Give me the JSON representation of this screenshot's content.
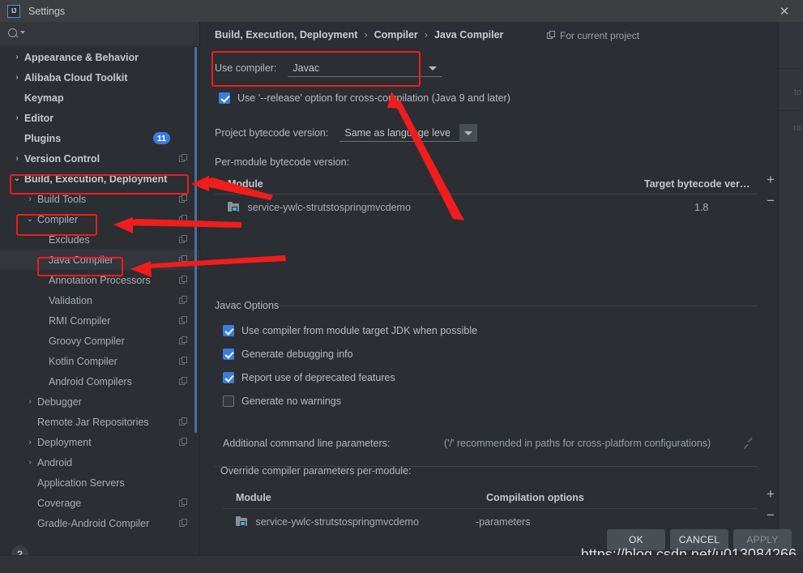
{
  "window": {
    "title": "Settings",
    "logo_text": "IJ",
    "close_label": "✕"
  },
  "search": {
    "placeholder": "",
    "value": "",
    "icon": "search-icon"
  },
  "sidebar": {
    "items": [
      {
        "label": "Appearance & Behavior",
        "twisty": "›",
        "bold": true,
        "indent": 30,
        "copy": false,
        "badge": null,
        "selected": false
      },
      {
        "label": "Alibaba Cloud Toolkit",
        "twisty": "›",
        "bold": true,
        "indent": 30,
        "copy": false,
        "badge": null,
        "selected": false
      },
      {
        "label": "Keymap",
        "twisty": "",
        "bold": true,
        "indent": 30,
        "copy": false,
        "badge": null,
        "selected": false
      },
      {
        "label": "Editor",
        "twisty": "›",
        "bold": true,
        "indent": 30,
        "copy": false,
        "badge": null,
        "selected": false
      },
      {
        "label": "Plugins",
        "twisty": "",
        "bold": true,
        "indent": 30,
        "copy": false,
        "badge": "11",
        "selected": false
      },
      {
        "label": "Version Control",
        "twisty": "›",
        "bold": true,
        "indent": 30,
        "copy": true,
        "badge": null,
        "selected": false
      },
      {
        "label": "Build, Execution, Deployment",
        "twisty": "⌄",
        "bold": true,
        "indent": 30,
        "copy": false,
        "badge": null,
        "selected": false
      },
      {
        "label": "Build Tools",
        "twisty": "›",
        "bold": false,
        "indent": 46,
        "copy": true,
        "badge": null,
        "selected": false
      },
      {
        "label": "Compiler",
        "twisty": "⌄",
        "bold": false,
        "indent": 46,
        "copy": true,
        "badge": null,
        "selected": false
      },
      {
        "label": "Excludes",
        "twisty": "",
        "bold": false,
        "indent": 60,
        "copy": true,
        "badge": null,
        "selected": false
      },
      {
        "label": "Java Compiler",
        "twisty": "",
        "bold": false,
        "indent": 60,
        "copy": true,
        "badge": null,
        "selected": true
      },
      {
        "label": "Annotation Processors",
        "twisty": "",
        "bold": false,
        "indent": 60,
        "copy": true,
        "badge": null,
        "selected": false
      },
      {
        "label": "Validation",
        "twisty": "",
        "bold": false,
        "indent": 60,
        "copy": true,
        "badge": null,
        "selected": false
      },
      {
        "label": "RMI Compiler",
        "twisty": "",
        "bold": false,
        "indent": 60,
        "copy": true,
        "badge": null,
        "selected": false
      },
      {
        "label": "Groovy Compiler",
        "twisty": "",
        "bold": false,
        "indent": 60,
        "copy": true,
        "badge": null,
        "selected": false
      },
      {
        "label": "Kotlin Compiler",
        "twisty": "",
        "bold": false,
        "indent": 60,
        "copy": true,
        "badge": null,
        "selected": false
      },
      {
        "label": "Android Compilers",
        "twisty": "",
        "bold": false,
        "indent": 60,
        "copy": true,
        "badge": null,
        "selected": false
      },
      {
        "label": "Debugger",
        "twisty": "›",
        "bold": false,
        "indent": 46,
        "copy": false,
        "badge": null,
        "selected": false
      },
      {
        "label": "Remote Jar Repositories",
        "twisty": "",
        "bold": false,
        "indent": 46,
        "copy": true,
        "badge": null,
        "selected": false
      },
      {
        "label": "Deployment",
        "twisty": "›",
        "bold": false,
        "indent": 46,
        "copy": true,
        "badge": null,
        "selected": false
      },
      {
        "label": "Android",
        "twisty": "›",
        "bold": false,
        "indent": 46,
        "copy": false,
        "badge": null,
        "selected": false
      },
      {
        "label": "Application Servers",
        "twisty": "",
        "bold": false,
        "indent": 46,
        "copy": false,
        "badge": null,
        "selected": false
      },
      {
        "label": "Coverage",
        "twisty": "",
        "bold": false,
        "indent": 46,
        "copy": true,
        "badge": null,
        "selected": false
      },
      {
        "label": "Gradle-Android Compiler",
        "twisty": "",
        "bold": false,
        "indent": 46,
        "copy": true,
        "badge": null,
        "selected": false
      }
    ],
    "help_label": "?"
  },
  "breadcrumb": {
    "part1": "Build, Execution, Deployment",
    "sep1": "›",
    "part2": "Compiler",
    "sep2": "›",
    "part3": "Java Compiler",
    "scope": "For current project"
  },
  "main": {
    "use_compiler_label": "Use compiler:",
    "use_compiler_value": "Javac",
    "release_option_label": "Use '--release' option for cross-compilation (Java 9 and later)",
    "release_option_checked": true,
    "project_bytecode_label": "Project bytecode version:",
    "project_bytecode_value": "Same as language leve",
    "per_module_label": "Per-module bytecode version:",
    "bytecode_table": {
      "col_module": "Module",
      "col_target": "Target bytecode ver…",
      "rows": [
        {
          "module": "service-ywlc-strutstospringmvcdemo",
          "target": "1.8"
        }
      ],
      "add_label": "+",
      "remove_label": "−"
    },
    "javac_options_title": "Javac Options",
    "javac_checkboxes": [
      {
        "label": "Use compiler from module target JDK when possible",
        "checked": true
      },
      {
        "label": "Generate debugging info",
        "checked": true
      },
      {
        "label": "Report use of deprecated features",
        "checked": true
      },
      {
        "label": "Generate no warnings",
        "checked": false
      }
    ],
    "additional_params_label": "Additional command line parameters:",
    "additional_params_hint": "('/' recommended in paths for cross-platform configurations)",
    "additional_params_value": "",
    "override_label": "Override compiler parameters per-module:",
    "override_table": {
      "col_module": "Module",
      "col_options": "Compilation options",
      "rows": [
        {
          "module": "service-ywlc-strutstospringmvcdemo",
          "options": "-parameters"
        }
      ],
      "add_label": "+",
      "remove_label": "−"
    }
  },
  "buttons": {
    "ok": "OK",
    "cancel": "CANCEL",
    "apply": "APPLY"
  },
  "watermark": "https://blog.csdn.net/u013084266",
  "bg_sliver": {
    "line1": "to",
    "line2": "ra"
  },
  "colors": {
    "accent": "#3b7ddd",
    "annotation": "#f11c1c",
    "panel_bg": "#2b2e33",
    "titlebar_bg": "#3c3f41",
    "text": "#b7bcc4"
  }
}
